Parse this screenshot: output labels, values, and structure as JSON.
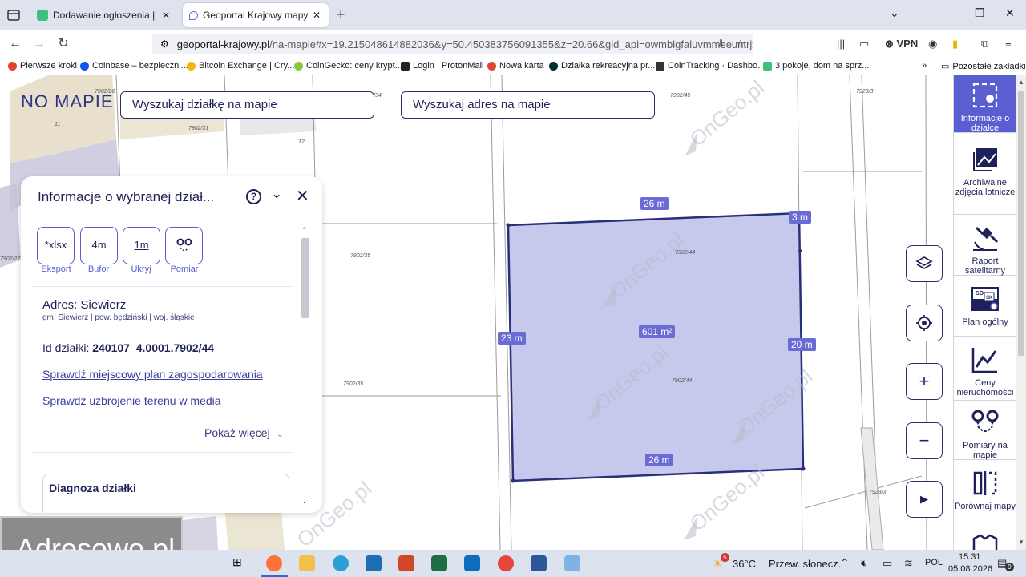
{
  "browser": {
    "tabs": [
      {
        "title": "Dodawanie ogłoszenia | Otodom",
        "favicon_color": "#3fbf7f",
        "active": false
      },
      {
        "title": "Geoportal Krajowy mapy i informacje",
        "favicon_color": "#6b6bd6",
        "active": true
      }
    ],
    "url_host": "geoportal-krajowy.pl",
    "url_path": "/na-mapie#x=19.215048614882036&y=50.450383756091355&z=20.66&gid_api=owmblgfaluvmmeeuntrjxcbj",
    "vpn_label": "VPN",
    "bookmarks": [
      {
        "label": "Pierwsze kroki",
        "color": "#e0442c"
      },
      {
        "label": "Coinbase – bezpieczni...",
        "color": "#1652f0"
      },
      {
        "label": "Bitcoin Exchange | Cry...",
        "color": "#f0b90b"
      },
      {
        "label": "CoinGecko: ceny krypt...",
        "color": "#8dc63f"
      },
      {
        "label": "Login | ProtonMail",
        "color": "#222222"
      },
      {
        "label": "Nowa karta",
        "color": "#e0442c"
      },
      {
        "label": "Działka rekreacyjna pr...",
        "color": "#002f34"
      },
      {
        "label": "CoinTracking · Dashbo...",
        "color": "#333333"
      },
      {
        "label": "3 pokoje, dom na sprz...",
        "color": "#3fbf7f"
      }
    ],
    "other_bookmarks": "Pozostałe zakładki"
  },
  "map": {
    "logo": "NO MAPIE",
    "search_parcel": "Wyszukaj działkę na mapie",
    "search_address": "Wyszukaj adres na mapie",
    "parcel_labels": [
      "7902/26",
      "7902/31",
      "7902/45",
      "7923/3",
      "7902/35",
      "7902/44",
      "7902/44",
      "7902/35",
      "7923/3",
      "7902/27",
      "11",
      "12",
      "/34"
    ],
    "dimensions": {
      "top": "26 m",
      "top_right": "3 m",
      "left": "23 m",
      "right": "20 m",
      "bottom": "26 m",
      "area": "601 m²"
    },
    "watermark_text": "OnGeo.pl",
    "parcel_fill": "#c7c9ec",
    "parcel_stroke": "#28307a",
    "accent": "#5a5ed0"
  },
  "sidebar": {
    "items": [
      {
        "label": "Informacje o działce",
        "icon": "parcel-info-icon",
        "active": true
      },
      {
        "label": "Archiwalne zdjęcia lotnicze",
        "icon": "aerial-photos-icon",
        "active": false
      },
      {
        "label": "Raport satelitarny",
        "icon": "satellite-icon",
        "active": false
      },
      {
        "label": "Plan ogólny",
        "icon": "general-plan-icon",
        "active": false
      },
      {
        "label": "Ceny nieruchomości",
        "icon": "price-chart-icon",
        "active": false
      },
      {
        "label": "Pomiary na mapie",
        "icon": "measure-icon",
        "active": false
      },
      {
        "label": "Porównaj mapy",
        "icon": "compare-maps-icon",
        "active": false
      }
    ]
  },
  "panel": {
    "title": "Informacje o wybranej dział...",
    "help": "?",
    "tools": [
      {
        "icon_text": "*xlsx",
        "label": "Eksport"
      },
      {
        "icon_text": "4m",
        "label": "Bufor"
      },
      {
        "icon_text": "1m",
        "label": "Ukryj"
      },
      {
        "icon_text": "",
        "label": "Pomiar"
      }
    ],
    "address_label": "Adres: Siewierz",
    "address_sub": "gm. Siewierz | pow. będziński | woj. śląskie",
    "id_label": "Id działki:",
    "id_value": "240107_4.0001.7902/44",
    "link_plan": "Sprawdź miejscowy plan zagospodarowania",
    "link_media": "Sprawdź uzbrojenie terenu w media",
    "show_more": "Pokaż więcej",
    "diagnosis_title": "Diagnoza działki"
  },
  "overlay_watermark": "Adresowo.pl",
  "taskbar": {
    "weather_temp": "36°C",
    "weather_desc": "Przew. słonecz.",
    "weather_badge": "5",
    "lang": "POL",
    "time": "15:31",
    "date": "05.08.2026",
    "notif_count": "9"
  }
}
